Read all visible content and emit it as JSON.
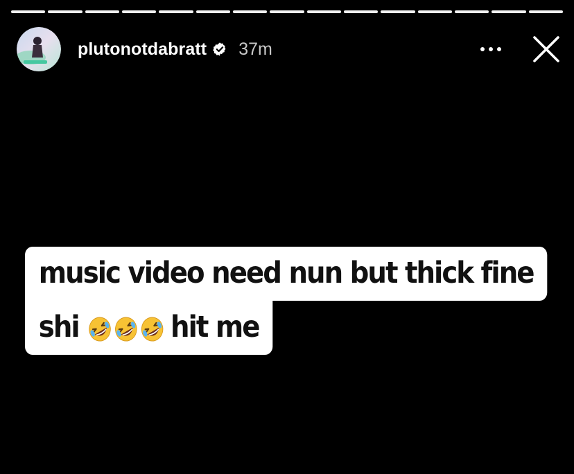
{
  "story": {
    "segments_total": 15,
    "segments_viewed": 15,
    "header": {
      "username": "plutonotdabratt",
      "verified_icon": "verified-badge-icon",
      "time_ago": "37m",
      "more_icon": "more-options-icon",
      "close_icon": "close-icon"
    },
    "caption": {
      "line1": "music video need nun but thick fine",
      "line2_before": "shi",
      "line2_emoji": "rolling-on-the-floor-laughing-emoji",
      "line2_emoji_count": 3,
      "line2_after": "hit me"
    }
  },
  "colors": {
    "background": "#000000",
    "text": "#ffffff",
    "caption_bg": "#ffffff",
    "caption_text": "#111111"
  }
}
